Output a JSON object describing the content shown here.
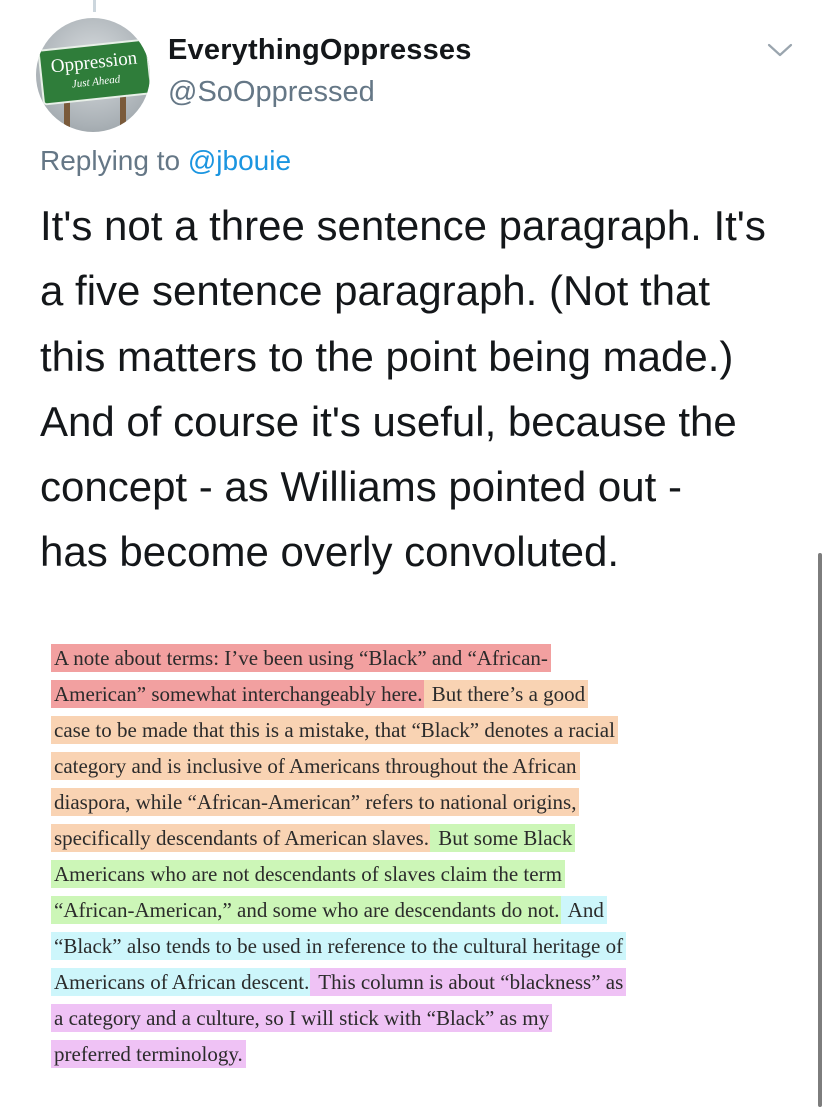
{
  "tweet": {
    "avatar": {
      "sign_text": "Oppression",
      "sign_subtext": "Just Ahead",
      "sign_color": "#2f7d3a"
    },
    "display_name": "EverythingOppresses",
    "handle": "@SoOppressed",
    "menu_icon": "chevron-down-icon",
    "replying_prefix": "Replying to",
    "replying_to": "@jbouie",
    "text_lines": [
      "It's not a three sentence paragraph. It's",
      "a five sentence paragraph. (Not that",
      "this matters to the point being made.)",
      "And of course it's useful, because the",
      "concept - as Williams pointed out -",
      "has become overly convoluted."
    ]
  },
  "excerpt": {
    "highlight_colors": {
      "red": "#f2a0a0",
      "orange": "#f9d3b3",
      "green": "#ccf6b7",
      "blue": "#cdf6fb",
      "purple": "#efc2f5"
    },
    "lines": [
      [
        {
          "text": "A note about terms: I’ve been using “Black” and “African-",
          "color": "red"
        }
      ],
      [
        {
          "text": "American” somewhat interchangeably here.",
          "color": "red"
        },
        {
          "text": " But there’s a good",
          "color": "orange"
        }
      ],
      [
        {
          "text": "case to be made that this is a mistake, that “Black” denotes a racial",
          "color": "orange"
        }
      ],
      [
        {
          "text": "category and is inclusive of Americans throughout the African",
          "color": "orange"
        }
      ],
      [
        {
          "text": "diaspora, while “African-American” refers to national origins,",
          "color": "orange"
        }
      ],
      [
        {
          "text": "specifically descendants of American slaves.",
          "color": "orange"
        },
        {
          "text": " But some Black",
          "color": "green"
        }
      ],
      [
        {
          "text": "Americans who are not descendants of slaves claim the term",
          "color": "green"
        }
      ],
      [
        {
          "text": "“African-American,” and some who are descendants do not.",
          "color": "green"
        },
        {
          "text": " And",
          "color": "blue"
        }
      ],
      [
        {
          "text": "“Black” also tends to be used in reference to the cultural heritage of",
          "color": "blue"
        }
      ],
      [
        {
          "text": "Americans of African descent.",
          "color": "blue"
        },
        {
          "text": " This column is about “blackness” as",
          "color": "purple"
        }
      ],
      [
        {
          "text": "a category and a culture, so I will stick with “Black” as my",
          "color": "purple"
        }
      ],
      [
        {
          "text": "preferred terminology.",
          "color": "purple"
        }
      ]
    ]
  }
}
